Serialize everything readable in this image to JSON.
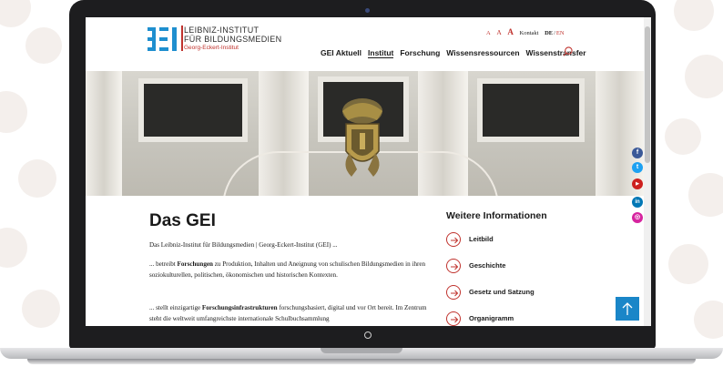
{
  "header": {
    "logo": {
      "line1": "LEIBNIZ-INSTITUT",
      "line2": "FÜR BILDUNGSMEDIEN",
      "line3": "Georg-Eckert-Institut",
      "mark_text": "GEI"
    },
    "utility": {
      "font_small": "A",
      "font_medium": "A",
      "font_large": "A",
      "contact": "Kontakt",
      "lang_de": "DE",
      "lang_sep": "/",
      "lang_en": "EN"
    },
    "nav": [
      {
        "label": "GEI Aktuell",
        "active": false
      },
      {
        "label": "Institut",
        "active": true
      },
      {
        "label": "Forschung",
        "active": false
      },
      {
        "label": "Wissensressourcen",
        "active": false
      },
      {
        "label": "Wissenstransfer",
        "active": false
      }
    ],
    "search_icon": "search-icon"
  },
  "social": [
    {
      "name": "facebook-icon",
      "glyph": "f",
      "color": "#3b5998"
    },
    {
      "name": "twitter-icon",
      "glyph": "t",
      "color": "#1da1f2"
    },
    {
      "name": "youtube-icon",
      "glyph": "▶",
      "color": "#cd201f"
    },
    {
      "name": "linkedin-icon",
      "glyph": "in",
      "color": "#0077b5"
    },
    {
      "name": "instagram-icon",
      "glyph": "◎",
      "color": "#d6249f"
    }
  ],
  "main": {
    "title": "Das GEI",
    "intro": "Das Leibniz-Institut für Bildungsmedien | Georg-Eckert-Institut (GEI) ...",
    "p1_pre": "... betreibt ",
    "p1_bold": "Forschungen",
    "p1_post": " zu Produktion, Inhalten und Aneignung von schulischen Bildungsmedien in ihren soziokulturellen, politischen, ökonomischen und historischen Kontexten.",
    "p2_pre": "... stellt einzigartige ",
    "p2_bold": "Forschungsinfrastrukturen",
    "p2_post": " forschungsbasiert, digital und vor Ort bereit. Im Zentrum steht die weltweit umfangreichste internationale Schulbuchsammlung"
  },
  "sidebar": {
    "title": "Weitere Informationen",
    "links": [
      {
        "label": "Leitbild"
      },
      {
        "label": "Geschichte"
      },
      {
        "label": "Gesetz und Satzung"
      },
      {
        "label": "Organigramm"
      }
    ]
  },
  "colors": {
    "brand_red": "#c0332e",
    "brand_blue": "#1a86c8",
    "logo_blue": "#1f8fcf"
  }
}
